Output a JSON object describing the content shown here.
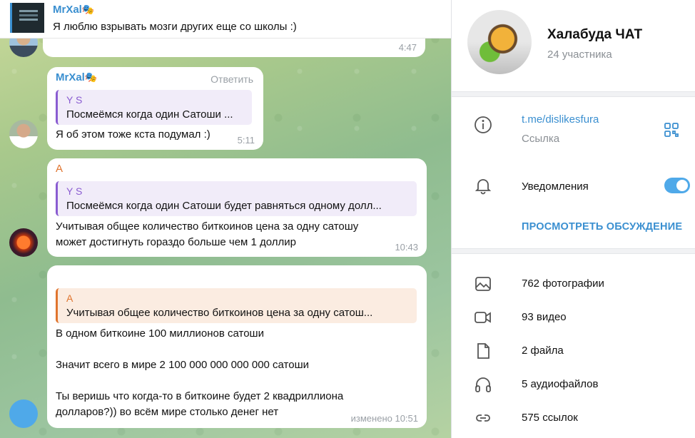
{
  "pinned": {
    "name": "MrXal",
    "icon": "theater-mask-icon",
    "text": "Я люблю взрывать мозги других еще со школы :)"
  },
  "messages": [
    {
      "time": "4:47"
    },
    {
      "sender": "MrXal",
      "reply_label": "Ответить",
      "quote_name": "Y S",
      "quote_text": "Посмеёмся когда один Сатоши ...",
      "text": "Я об этом тоже кста подумал :)",
      "time": "5:11"
    },
    {
      "sender": "A",
      "quote_name": "Y S",
      "quote_text": "Посмеёмся когда один Сатоши будет равняться одному долл...",
      "text": "Учитывая общее количество биткоинов цена за одну сатошу\nможет достигнуть гораздо больше чем 1 доллир",
      "time": "10:43"
    },
    {
      "quote_name": "A",
      "quote_text": "Учитывая общее количество биткоинов цена за одну сатош...",
      "text": "В одном биткоине 100 миллионов сатоши\n\nЗначит всего в мире 2 100 000 000 000 000 сатоши\n\nТы веришь что когда-то в биткоине будет 2 квадриллиона\nдолларов?)) во всём мире столько денег нет",
      "time": "изменено 10:51"
    }
  ],
  "group": {
    "title": "Халабуда ЧАТ",
    "members": "24 участника",
    "link": "t.me/dislikesfura",
    "link_label": "Ссылка",
    "notifications_label": "Уведомления",
    "notifications_on": true,
    "discussion_button": "ПРОСМОТРЕТЬ ОБСУЖДЕНИЕ"
  },
  "media": [
    {
      "icon": "photo-icon",
      "label": "762 фотографии"
    },
    {
      "icon": "video-icon",
      "label": "93 видео"
    },
    {
      "icon": "file-icon",
      "label": "2 файла"
    },
    {
      "icon": "headphones-icon",
      "label": "5 аудиофайлов"
    },
    {
      "icon": "link-icon",
      "label": "575 ссылок"
    }
  ],
  "colors": {
    "accent": "#3a8fd0",
    "quote_violet": "#8a5cd1",
    "quote_orange": "#e0742e"
  }
}
